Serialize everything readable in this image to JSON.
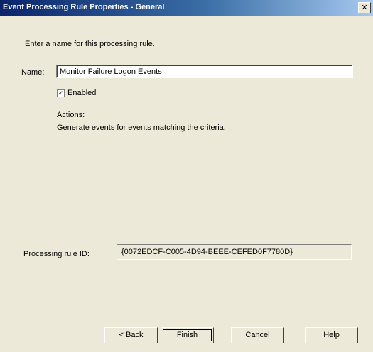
{
  "window": {
    "title": "Event Processing Rule Properties - General",
    "close_glyph": "✕"
  },
  "general": {
    "instruction": "Enter a name for this processing rule.",
    "name_label": "Name:",
    "name_value": "Monitor Failure Logon Events",
    "enabled_label": "Enabled",
    "enabled_checked": true,
    "actions_title": "Actions:",
    "actions_description": "Generate events for events matching the criteria."
  },
  "identity": {
    "label": "Processing rule ID:",
    "value": "{0072EDCF-C005-4D94-BEEE-CEFED0F7780D}"
  },
  "buttons": {
    "back": "< Back",
    "finish": "Finish",
    "cancel": "Cancel",
    "help": "Help"
  }
}
